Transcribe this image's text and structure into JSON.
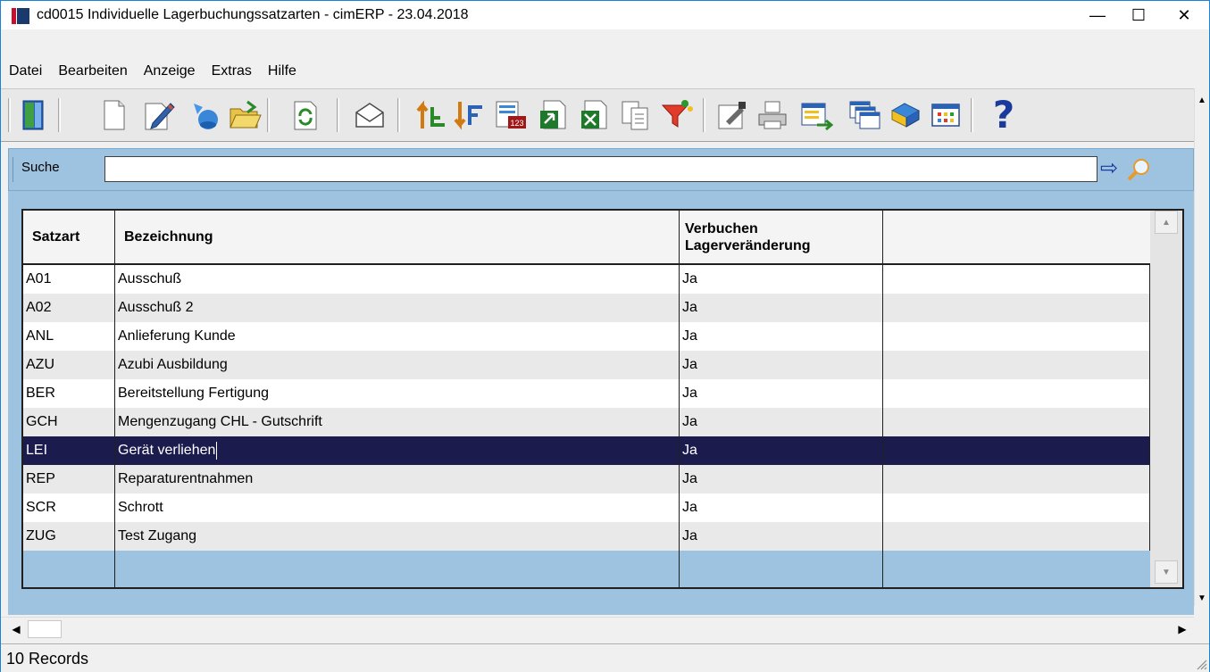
{
  "window": {
    "title": "cd0015 Individuelle Lagerbuchungssatzarten - cimERP - 23.04.2018",
    "minimize_glyph": "—",
    "maximize_glyph": "☐",
    "close_glyph": "✕"
  },
  "menu": {
    "items": [
      "Datei",
      "Bearbeiten",
      "Anzeige",
      "Extras",
      "Hilfe"
    ]
  },
  "toolbar": {
    "icons": [
      "exit-icon",
      "new-document-icon",
      "edit-icon",
      "copy-record-icon",
      "open-folder-icon",
      "refresh-icon",
      "mail-icon",
      "sort-ascending-icon",
      "sort-descending-icon",
      "numbering-icon",
      "export-icon",
      "excel-export-icon",
      "copy-icon",
      "filter-icon",
      "properties-icon",
      "print-icon",
      "transfer-icon",
      "windows-icon",
      "books-icon",
      "grid-icon",
      "help-icon"
    ],
    "help_glyph": "?"
  },
  "search": {
    "label": "Suche",
    "value": "",
    "go_glyph": "⇨"
  },
  "grid": {
    "columns": [
      "Satzart",
      "Bezeichnung",
      "Verbuchen Lagerveränderung",
      ""
    ],
    "column_header_line1": "Verbuchen",
    "column_header_line2": "Lagerveränderung",
    "rows": [
      {
        "satzart": "A01",
        "bezeichnung": "Ausschuß",
        "verbuchen": "Ja"
      },
      {
        "satzart": "A02",
        "bezeichnung": "Ausschuß 2",
        "verbuchen": "Ja"
      },
      {
        "satzart": "ANL",
        "bezeichnung": "Anlieferung Kunde",
        "verbuchen": "Ja"
      },
      {
        "satzart": "AZU",
        "bezeichnung": "Azubi Ausbildung",
        "verbuchen": "Ja"
      },
      {
        "satzart": "BER",
        "bezeichnung": "Bereitstellung Fertigung",
        "verbuchen": "Ja"
      },
      {
        "satzart": "GCH",
        "bezeichnung": "Mengenzugang CHL - Gutschrift",
        "verbuchen": "Ja"
      },
      {
        "satzart": "LEI",
        "bezeichnung": "Gerät verliehen",
        "verbuchen": "Ja"
      },
      {
        "satzart": "REP",
        "bezeichnung": "Reparaturentnahmen",
        "verbuchen": "Ja"
      },
      {
        "satzart": "SCR",
        "bezeichnung": "Schrott",
        "verbuchen": "Ja"
      },
      {
        "satzart": "ZUG",
        "bezeichnung": "Test Zugang",
        "verbuchen": "Ja"
      }
    ],
    "selected_index": 6
  },
  "status": {
    "text": "10 Records"
  },
  "colors": {
    "panel": "#9dc3e0",
    "selected_row": "#1b1b4e",
    "brand_red": "#c8102e",
    "brand_navy": "#1a3a6e"
  }
}
